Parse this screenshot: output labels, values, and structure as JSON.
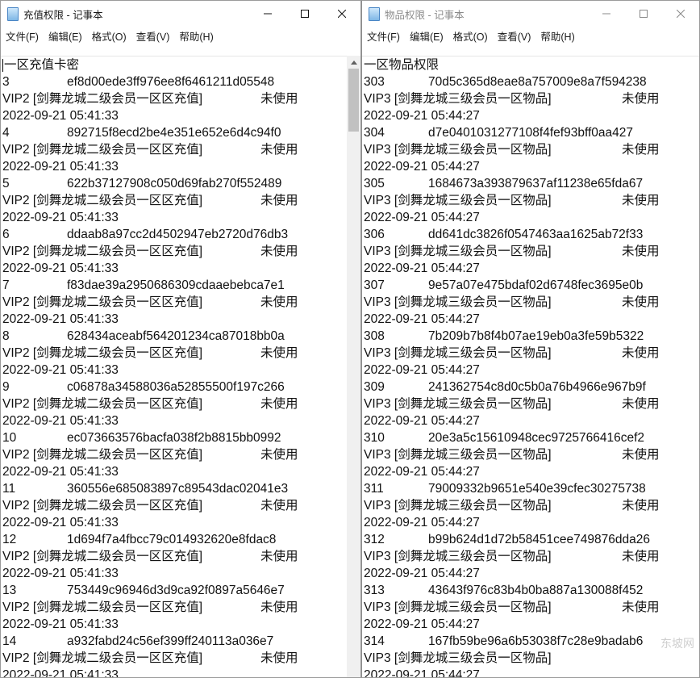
{
  "window1": {
    "title": "充值权限 - 记事本",
    "menu": [
      "文件(F)",
      "编辑(E)",
      "格式(O)",
      "查看(V)",
      "帮助(H)"
    ],
    "header": "一区充值卡密",
    "entries": [
      {
        "num": "3",
        "code": "ef8d00ede3ff976ee8f6461211d05548",
        "desc": "VIP2 [剑舞龙城二级会员一区区充值]",
        "status": "未使用",
        "date": "2022-09-21 05:41:33"
      },
      {
        "num": "4",
        "code": "892715f8ecd2be4e351e652e6d4c94f0",
        "desc": "VIP2 [剑舞龙城二级会员一区区充值]",
        "status": "未使用",
        "date": "2022-09-21 05:41:33"
      },
      {
        "num": "5",
        "code": "622b37127908c050d69fab270f552489",
        "desc": "VIP2 [剑舞龙城二级会员一区区充值]",
        "status": "未使用",
        "date": "2022-09-21 05:41:33"
      },
      {
        "num": "6",
        "code": "ddaab8a97cc2d4502947eb2720d76db3",
        "desc": "VIP2 [剑舞龙城二级会员一区区充值]",
        "status": "未使用",
        "date": "2022-09-21 05:41:33"
      },
      {
        "num": "7",
        "code": "f83dae39a2950686309cdaaebebca7e1",
        "desc": "VIP2 [剑舞龙城二级会员一区区充值]",
        "status": "未使用",
        "date": "2022-09-21 05:41:33"
      },
      {
        "num": "8",
        "code": "628434aceabf564201234ca87018bb0a",
        "desc": "VIP2 [剑舞龙城二级会员一区区充值]",
        "status": "未使用",
        "date": "2022-09-21 05:41:33"
      },
      {
        "num": "9",
        "code": "c06878a34588036a52855500f197c266",
        "desc": "VIP2 [剑舞龙城二级会员一区区充值]",
        "status": "未使用",
        "date": "2022-09-21 05:41:33"
      },
      {
        "num": "10",
        "code": "ec073663576bacfa038f2b8815bb0992",
        "desc": "VIP2 [剑舞龙城二级会员一区区充值]",
        "status": "未使用",
        "date": "2022-09-21 05:41:33"
      },
      {
        "num": "11",
        "code": "360556e685083897c89543dac02041e3",
        "desc": "VIP2 [剑舞龙城二级会员一区区充值]",
        "status": "未使用",
        "date": "2022-09-21 05:41:33"
      },
      {
        "num": "12",
        "code": "1d694f7a4fbcc79c014932620e8fdac8",
        "desc": "VIP2 [剑舞龙城二级会员一区区充值]",
        "status": "未使用",
        "date": "2022-09-21 05:41:33"
      },
      {
        "num": "13",
        "code": "753449c96946d3d9ca92f0897a5646e7",
        "desc": "VIP2 [剑舞龙城二级会员一区区充值]",
        "status": "未使用",
        "date": "2022-09-21 05:41:33"
      },
      {
        "num": "14",
        "code": "a932fabd24c56ef399ff240113a036e7",
        "desc": "VIP2 [剑舞龙城二级会员一区区充值]",
        "status": "未使用",
        "date": "2022-09-21 05:41:33"
      }
    ]
  },
  "window2": {
    "title": "物品权限 - 记事本",
    "menu": [
      "文件(F)",
      "编辑(E)",
      "格式(O)",
      "查看(V)",
      "帮助(H)"
    ],
    "header": "一区物品权限",
    "entries": [
      {
        "num": "303",
        "code": "70d5c365d8eae8a757009e8a7f594238",
        "desc": "VIP3 [剑舞龙城三级会员一区物品]",
        "status": "未使用",
        "date": "2022-09-21 05:44:27"
      },
      {
        "num": "304",
        "code": "d7e0401031277108f4fef93bff0aa427",
        "desc": "VIP3 [剑舞龙城三级会员一区物品]",
        "status": "未使用",
        "date": "2022-09-21 05:44:27"
      },
      {
        "num": "305",
        "code": "1684673a393879637af11238e65fda67",
        "desc": "VIP3 [剑舞龙城三级会员一区物品]",
        "status": "未使用",
        "date": "2022-09-21 05:44:27"
      },
      {
        "num": "306",
        "code": "dd641dc3826f0547463aa1625ab72f33",
        "desc": "VIP3 [剑舞龙城三级会员一区物品]",
        "status": "未使用",
        "date": "2022-09-21 05:44:27"
      },
      {
        "num": "307",
        "code": "9e57a07e475bdaf02d6748fec3695e0b",
        "desc": "VIP3 [剑舞龙城三级会员一区物品]",
        "status": "未使用",
        "date": "2022-09-21 05:44:27"
      },
      {
        "num": "308",
        "code": "7b209b7b8f4b07ae19eb0a3fe59b5322",
        "desc": "VIP3 [剑舞龙城三级会员一区物品]",
        "status": "未使用",
        "date": "2022-09-21 05:44:27"
      },
      {
        "num": "309",
        "code": "241362754c8d0c5b0a76b4966e967b9f",
        "desc": "VIP3 [剑舞龙城三级会员一区物品]",
        "status": "未使用",
        "date": "2022-09-21 05:44:27"
      },
      {
        "num": "310",
        "code": "20e3a5c15610948cec9725766416cef2",
        "desc": "VIP3 [剑舞龙城三级会员一区物品]",
        "status": "未使用",
        "date": "2022-09-21 05:44:27"
      },
      {
        "num": "311",
        "code": "79009332b9651e540e39cfec30275738",
        "desc": "VIP3 [剑舞龙城三级会员一区物品]",
        "status": "未使用",
        "date": "2022-09-21 05:44:27"
      },
      {
        "num": "312",
        "code": "b99b624d1d72b58451cee749876dda26",
        "desc": "VIP3 [剑舞龙城三级会员一区物品]",
        "status": "未使用",
        "date": "2022-09-21 05:44:27"
      },
      {
        "num": "313",
        "code": "43643f976c83b4b0ba887a130088f452",
        "desc": "VIP3 [剑舞龙城三级会员一区物品]",
        "status": "未使用",
        "date": "2022-09-21 05:44:27"
      },
      {
        "num": "314",
        "code": "167fb59be96a6b53038f7c28e9badab6",
        "desc": "VIP3 [剑舞龙城三级会员一区物品]",
        "status": "",
        "date": "2022-09-21 05:44:27"
      }
    ],
    "watermark": "东坡网"
  }
}
